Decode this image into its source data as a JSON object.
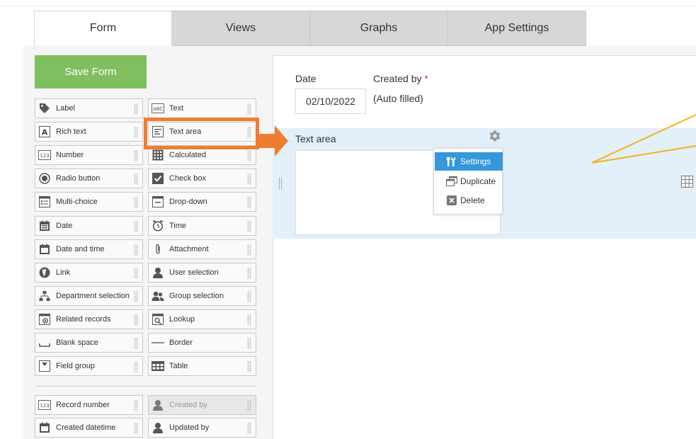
{
  "tabs": [
    {
      "label": "Form"
    },
    {
      "label": "Views"
    },
    {
      "label": "Graphs"
    },
    {
      "label": "App Settings"
    }
  ],
  "save_button": "Save Form",
  "palette": {
    "left": [
      {
        "label": "Label",
        "icon": "tag-icon"
      },
      {
        "label": "Rich text",
        "icon": "rich-text-icon"
      },
      {
        "label": "Number",
        "icon": "number-icon"
      },
      {
        "label": "Radio button",
        "icon": "radio-icon"
      },
      {
        "label": "Multi-choice",
        "icon": "multi-choice-icon"
      },
      {
        "label": "Date",
        "icon": "date-icon"
      },
      {
        "label": "Date and time",
        "icon": "datetime-icon"
      },
      {
        "label": "Link",
        "icon": "globe-icon"
      },
      {
        "label": "Department selection",
        "icon": "department-icon"
      },
      {
        "label": "Related records",
        "icon": "related-records-icon"
      },
      {
        "label": "Blank space",
        "icon": "blank-space-icon"
      },
      {
        "label": "Field group",
        "icon": "field-group-icon"
      }
    ],
    "right": [
      {
        "label": "Text",
        "icon": "text-icon"
      },
      {
        "label": "Text area",
        "icon": "text-area-icon"
      },
      {
        "label": "Calculated",
        "icon": "calculator-icon"
      },
      {
        "label": "Check box",
        "icon": "checkbox-icon"
      },
      {
        "label": "Drop-down",
        "icon": "dropdown-icon"
      },
      {
        "label": "Time",
        "icon": "clock-icon"
      },
      {
        "label": "Attachment",
        "icon": "paperclip-icon"
      },
      {
        "label": "User selection",
        "icon": "user-icon"
      },
      {
        "label": "Group selection",
        "icon": "group-icon"
      },
      {
        "label": "Lookup",
        "icon": "lookup-icon"
      },
      {
        "label": "Border",
        "icon": "border-icon"
      },
      {
        "label": "Table",
        "icon": "table-icon"
      }
    ],
    "system_left": [
      {
        "label": "Record number",
        "icon": "number-icon"
      },
      {
        "label": "Created datetime",
        "icon": "datetime-icon"
      }
    ],
    "system_right": [
      {
        "label": "Created by",
        "icon": "user-icon",
        "disabled": true
      },
      {
        "label": "Updated by",
        "icon": "user-icon"
      }
    ]
  },
  "form": {
    "date_label": "Date",
    "date_value": "02/10/2022",
    "created_by_label": "Created by",
    "required_mark": "*",
    "created_by_value": "(Auto filled)",
    "text_area_label": "Text area"
  },
  "menu": [
    {
      "label": "Settings",
      "icon": "tools-icon",
      "highlighted": true
    },
    {
      "label": "Duplicate",
      "icon": "duplicate-icon"
    },
    {
      "label": "Delete",
      "icon": "delete-icon"
    }
  ],
  "colors": {
    "save_green": "#7fbf5f",
    "highlight_orange": "#ee7d31",
    "callout_yellow": "#f2b418",
    "menu_blue": "#3498db",
    "selected_row": "#e3eff9"
  }
}
